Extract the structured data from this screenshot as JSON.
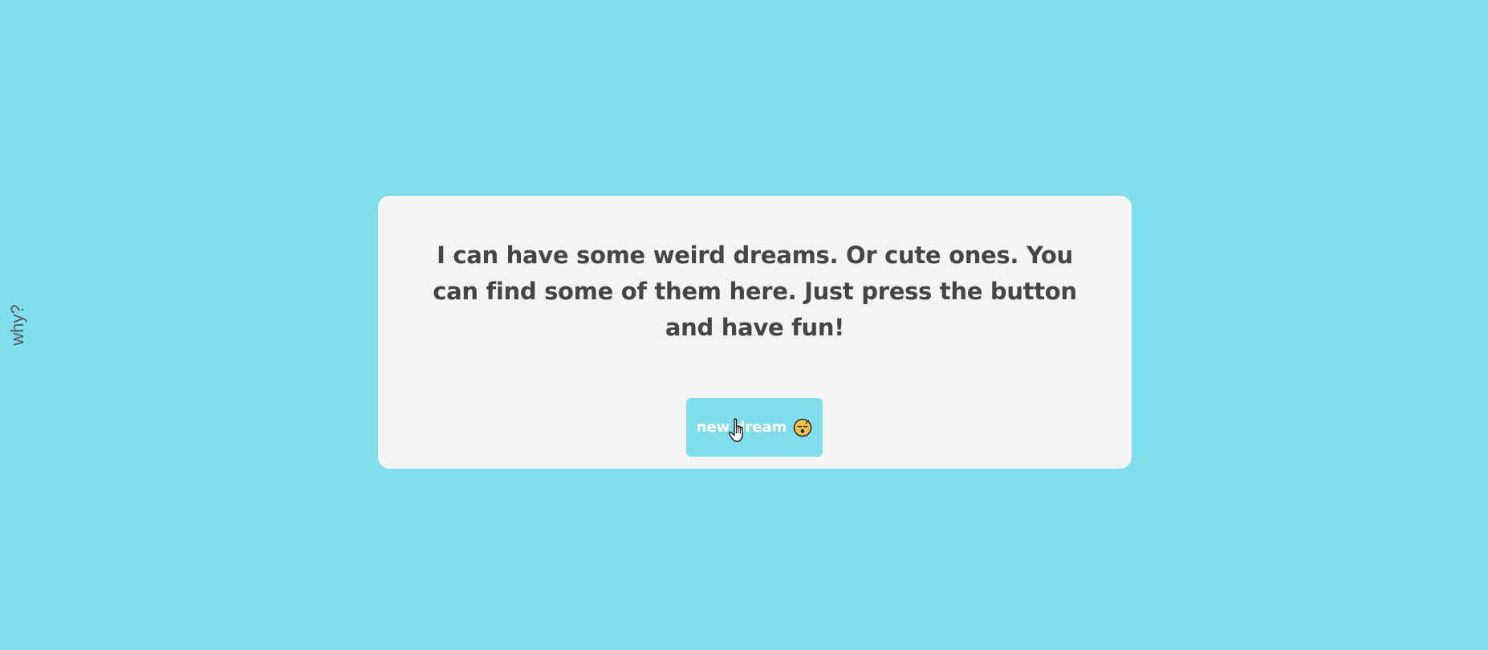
{
  "sidebar": {
    "why_label": "why?"
  },
  "card": {
    "intro_text": "I can have some weird dreams. Or cute ones. You can find some of them here. Just press the button and have fun!",
    "button_label": "new dream",
    "button_icon": "sleepy-face-icon"
  },
  "colors": {
    "background": "#80deea",
    "card": "#f4f4f4",
    "text": "#454545",
    "button_text": "#ffffff"
  }
}
